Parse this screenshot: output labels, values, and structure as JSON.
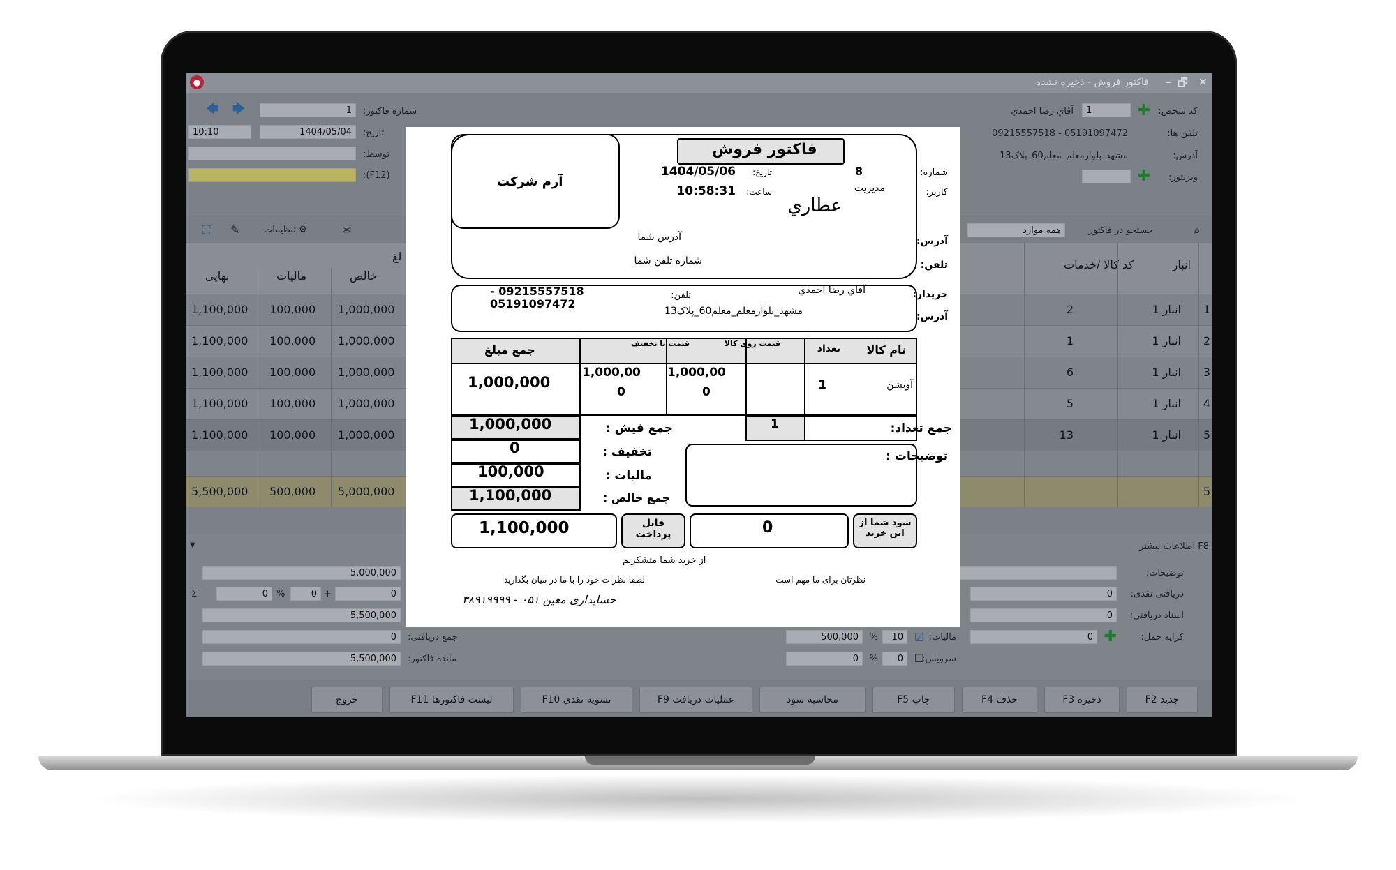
{
  "window": {
    "title": "فاکتور فروش - ذخیره نشده",
    "close": "✕",
    "minimize": "–",
    "restore": "🗗"
  },
  "header": {
    "invoice_no_label": "شماره فاکتور:",
    "invoice_no": "1",
    "date_label": "تاریخ:",
    "date": "1404/05/04",
    "time": "10:10",
    "by_label": "توسط:",
    "f12_label": "(F12):",
    "person_code_label": "کد شخص:",
    "person_code": "1",
    "person_name": "آقاي رضا احمدي",
    "phones_label": "تلفن ها:",
    "phones": "05191097472 - 09215557518",
    "address_label": "آدرس:",
    "address": "مشهد_بلوارمعلم_معلم60_پلاک13",
    "visitor_label": "ویزیتور:"
  },
  "toolbar": {
    "settings": "تنظیمات",
    "search_label": "جستجو در فاکتور",
    "search_scope": "همه موارد"
  },
  "grid": {
    "headers_left": [
      "نهایی",
      "مالیات",
      "خالص"
    ],
    "headers_right": [
      "کد کالا /خدمات",
      "انبار"
    ],
    "amount_header_fragment": "لغ",
    "rows": [
      {
        "num": "1",
        "store": "انبار 1",
        "code": "2",
        "final": "1,100,000",
        "tax": "100,000",
        "net": "1,000,000"
      },
      {
        "num": "2",
        "store": "انبار 1",
        "code": "1",
        "final": "1,100,000",
        "tax": "100,000",
        "net": "1,000,000"
      },
      {
        "num": "3",
        "store": "انبار 1",
        "code": "6",
        "final": "1,100,000",
        "tax": "100,000",
        "net": "1,000,000"
      },
      {
        "num": "4",
        "store": "انبار 1",
        "code": "5",
        "final": "1,100,000",
        "tax": "100,000",
        "net": "1,000,000"
      },
      {
        "num": "5",
        "store": "انبار 1",
        "code": "13",
        "final": "1,100,000",
        "tax": "100,000",
        "net": "1,000,000"
      }
    ],
    "totals": {
      "num": "5",
      "final": "5,500,000",
      "tax": "500,000",
      "net": "5,000,000"
    }
  },
  "more_info": {
    "title": "F8 اطلاعات بیشتر",
    "notes_label": "توضیحات:",
    "cash_received_label": "دریافتی نقدی:",
    "cash_received": "0",
    "docs_received_label": "اسناد دریافتی:",
    "docs_received": "0",
    "freight_label": "کرایه حمل:",
    "freight": "0",
    "tax_label": "مالیات:",
    "tax_percent": "10",
    "tax_amount": "500,000",
    "service_label": "سرویس:",
    "service_percent": "0",
    "service_amount": "0",
    "sum_net": "5,000,000",
    "disc_amount": "0",
    "disc_percent": "0",
    "sigma": "Σ",
    "plus": "+",
    "percent_sign": "%",
    "subtotal": "5,500,000",
    "total_received_label": "جمع دریافتی:",
    "total_received": "0",
    "balance_label": "مانده فاکتور:",
    "balance": "5,500,000"
  },
  "bottom_buttons": [
    "جدید F2",
    "ذخیره F3",
    "حذف F4",
    "چاپ F5",
    "محاسبه سود",
    "عملیات دریافت F9",
    "تسویه نقدي F10",
    "لیست فاکتورها F11",
    "خروج"
  ],
  "receipt": {
    "title": "فاکتور فروش",
    "company": "آرم شرکت",
    "number_label": "شماره:",
    "number": "8",
    "date_label": "تاریخ:",
    "date": "1404/05/06",
    "user_label": "کاربر:",
    "user": "مدیریت",
    "time_label": "ساعت:",
    "time": "10:58:31",
    "shop_name": "عطاري",
    "address_label": "آدرس:",
    "address": "آدرس شما",
    "phone_label": "تلفن:",
    "phone": "شماره تلفن شما",
    "buyer_label": "خریدار:",
    "buyer": "آقاي رضا احمدي",
    "buyer_phone_label": "تلفن:",
    "buyer_phone_1": "09215557518 -",
    "buyer_phone_2": "05191097472",
    "buyer_address_label": "آدرس:",
    "buyer_address": "مشهد_بلوارمعلم_معلم60_پلاک13",
    "table_headers": {
      "name": "نام کالا",
      "qty": "تعداد",
      "price": "قیمت روی کالا",
      "discounted": "قیمت با تخفیف",
      "sum": "جمع مبلغ"
    },
    "item": {
      "name": "آویشن",
      "qty": "1",
      "price_1": "1,000,00",
      "price_2": "0",
      "disc_1": "1,000,00",
      "disc_2": "0",
      "sum": "1,000,000"
    },
    "total_qty_label": "جمع تعداد:",
    "total_qty": "1",
    "notes_label": "توضیحات :",
    "sum_label": "جمع فیش :",
    "sum_value": "1,000,000",
    "discount_label": "تخفیف :",
    "discount_value": "0",
    "tax_label": "مالیات :",
    "tax_value": "100,000",
    "net_label": "جمع خالص :",
    "net_value": "1,100,000",
    "profit_label": "سود شما از این خرید",
    "profit_value": "0",
    "payable_label": "قابل پرداخت",
    "payable_value": "1,100,000",
    "thanks": "از خرید شما متشکریم",
    "footer_right": "نظرتان برای ما مهم است",
    "footer_left": "لطفا نظرات خود را با ما در میان بگذارید",
    "signature": "حسابداری معین ۰۵۱ - ۳۸۹۱۹۹۹۹"
  }
}
